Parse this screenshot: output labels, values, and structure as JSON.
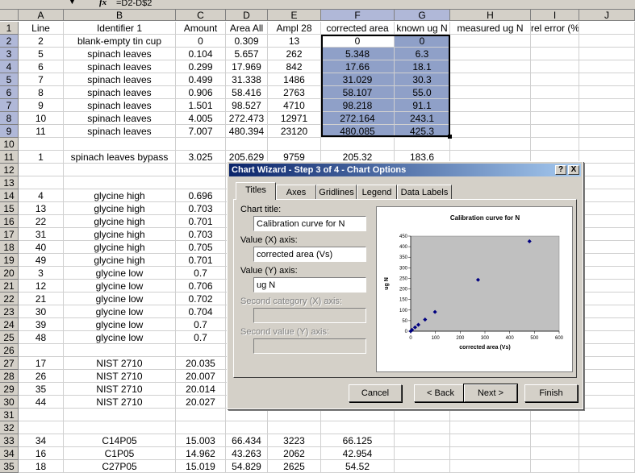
{
  "formula_bar": {
    "formula": "=D2-D$2"
  },
  "columns": [
    "A",
    "B",
    "C",
    "D",
    "E",
    "F",
    "G",
    "H",
    "I",
    "J"
  ],
  "rows": [
    {
      "n": "1",
      "cells": [
        "Line",
        "Identifier 1",
        "Amount",
        "Area All",
        "Ampl  28",
        "corrected area",
        "known ug N",
        "measured ug N",
        "rel error (%)",
        ""
      ]
    },
    {
      "n": "2",
      "cells": [
        "2",
        "blank-empty tin cup",
        "0",
        "0.309",
        "13",
        "0",
        "0",
        "",
        "",
        ""
      ]
    },
    {
      "n": "3",
      "cells": [
        "5",
        "spinach leaves",
        "0.104",
        "5.657",
        "262",
        "5.348",
        "6.3",
        "",
        "",
        ""
      ]
    },
    {
      "n": "4",
      "cells": [
        "6",
        "spinach leaves",
        "0.299",
        "17.969",
        "842",
        "17.66",
        "18.1",
        "",
        "",
        ""
      ]
    },
    {
      "n": "5",
      "cells": [
        "7",
        "spinach leaves",
        "0.499",
        "31.338",
        "1486",
        "31.029",
        "30.3",
        "",
        "",
        ""
      ]
    },
    {
      "n": "6",
      "cells": [
        "8",
        "spinach leaves",
        "0.906",
        "58.416",
        "2763",
        "58.107",
        "55.0",
        "",
        "",
        ""
      ]
    },
    {
      "n": "7",
      "cells": [
        "9",
        "spinach leaves",
        "1.501",
        "98.527",
        "4710",
        "98.218",
        "91.1",
        "",
        "",
        ""
      ]
    },
    {
      "n": "8",
      "cells": [
        "10",
        "spinach leaves",
        "4.005",
        "272.473",
        "12971",
        "272.164",
        "243.1",
        "",
        "",
        ""
      ]
    },
    {
      "n": "9",
      "cells": [
        "11",
        "spinach leaves",
        "7.007",
        "480.394",
        "23120",
        "480.085",
        "425.3",
        "",
        "",
        ""
      ]
    },
    {
      "n": "10",
      "cells": [
        "",
        "",
        "",
        "",
        "",
        "",
        "",
        "",
        "",
        ""
      ]
    },
    {
      "n": "11",
      "cells": [
        "1",
        "spinach leaves bypass",
        "3.025",
        "205.629",
        "9759",
        "205.32",
        "183.6",
        "",
        "",
        ""
      ]
    },
    {
      "n": "12",
      "cells": [
        "",
        "",
        "",
        "",
        "",
        "",
        "",
        "",
        "",
        ""
      ]
    },
    {
      "n": "13",
      "cells": [
        "",
        "",
        "",
        "",
        "",
        "",
        "",
        "",
        "",
        ""
      ]
    },
    {
      "n": "14",
      "cells": [
        "4",
        "glycine high",
        "0.696",
        "",
        "",
        "",
        "",
        "",
        "",
        ""
      ]
    },
    {
      "n": "15",
      "cells": [
        "13",
        "glycine high",
        "0.703",
        "",
        "",
        "",
        "",
        "",
        "",
        ""
      ]
    },
    {
      "n": "16",
      "cells": [
        "22",
        "glycine high",
        "0.701",
        "",
        "",
        "",
        "",
        "",
        "",
        ""
      ]
    },
    {
      "n": "17",
      "cells": [
        "31",
        "glycine high",
        "0.703",
        "",
        "",
        "",
        "",
        "",
        "",
        ""
      ]
    },
    {
      "n": "18",
      "cells": [
        "40",
        "glycine high",
        "0.705",
        "",
        "",
        "",
        "",
        "",
        "",
        ""
      ]
    },
    {
      "n": "19",
      "cells": [
        "49",
        "glycine high",
        "0.701",
        "",
        "",
        "",
        "",
        "",
        "",
        ""
      ]
    },
    {
      "n": "20",
      "cells": [
        "3",
        "glycine low",
        "0.7",
        "",
        "",
        "",
        "",
        "",
        "",
        ""
      ]
    },
    {
      "n": "21",
      "cells": [
        "12",
        "glycine low",
        "0.706",
        "",
        "",
        "",
        "",
        "",
        "",
        ""
      ]
    },
    {
      "n": "22",
      "cells": [
        "21",
        "glycine low",
        "0.702",
        "",
        "",
        "",
        "",
        "",
        "",
        ""
      ]
    },
    {
      "n": "23",
      "cells": [
        "30",
        "glycine low",
        "0.704",
        "",
        "",
        "",
        "",
        "",
        "",
        ""
      ]
    },
    {
      "n": "24",
      "cells": [
        "39",
        "glycine low",
        "0.7",
        "",
        "",
        "",
        "",
        "",
        "",
        ""
      ]
    },
    {
      "n": "25",
      "cells": [
        "48",
        "glycine low",
        "0.7",
        "",
        "",
        "",
        "",
        "",
        "",
        ""
      ]
    },
    {
      "n": "26",
      "cells": [
        "",
        "",
        "",
        "",
        "",
        "",
        "",
        "",
        "",
        ""
      ]
    },
    {
      "n": "27",
      "cells": [
        "17",
        "NIST 2710",
        "20.035",
        "",
        "",
        "",
        "",
        "",
        "",
        ""
      ]
    },
    {
      "n": "28",
      "cells": [
        "26",
        "NIST 2710",
        "20.007",
        "",
        "",
        "",
        "",
        "",
        "",
        ""
      ]
    },
    {
      "n": "29",
      "cells": [
        "35",
        "NIST 2710",
        "20.014",
        "",
        "",
        "",
        "",
        "",
        "",
        ""
      ]
    },
    {
      "n": "30",
      "cells": [
        "44",
        "NIST 2710",
        "20.027",
        "",
        "",
        "",
        "",
        "",
        "",
        ""
      ]
    },
    {
      "n": "31",
      "cells": [
        "",
        "",
        "",
        "",
        "",
        "",
        "",
        "",
        "",
        ""
      ]
    },
    {
      "n": "32",
      "cells": [
        "",
        "",
        "",
        "",
        "",
        "",
        "",
        "",
        "",
        ""
      ]
    },
    {
      "n": "33",
      "cells": [
        "34",
        "C14P05",
        "15.003",
        "66.434",
        "3223",
        "66.125",
        "",
        "",
        "",
        ""
      ]
    },
    {
      "n": "34",
      "cells": [
        "16",
        "C1P05",
        "14.962",
        "43.263",
        "2062",
        "42.954",
        "",
        "",
        "",
        ""
      ]
    },
    {
      "n": "35",
      "cells": [
        "18",
        "C27P05",
        "15.019",
        "54.829",
        "2625",
        "54.52",
        "",
        "",
        "",
        ""
      ]
    }
  ],
  "dialog": {
    "title": "Chart Wizard - Step 3 of 4 - Chart Options",
    "help_label": "?",
    "close_label": "X",
    "tabs": [
      "Titles",
      "Axes",
      "Gridlines",
      "Legend",
      "Data Labels"
    ],
    "chart_title_label": "Chart title:",
    "chart_title_value": "Calibration curve for N",
    "x_axis_label": "Value (X) axis:",
    "x_axis_value": "corrected area (Vs)",
    "y_axis_label": "Value (Y) axis:",
    "y_axis_value": "ug N",
    "second_x_label": "Second category (X) axis:",
    "second_y_label": "Second value (Y) axis:",
    "buttons": {
      "cancel": "Cancel",
      "back": "< Back",
      "next": "Next >",
      "finish": "Finish"
    }
  },
  "chart_data": {
    "type": "scatter",
    "title": "Calibration curve for N",
    "xlabel": "corrected area (Vs)",
    "ylabel": "ug N",
    "xlim": [
      0,
      600
    ],
    "ylim": [
      0,
      450
    ],
    "xticks": [
      "0",
      "100",
      "200",
      "300",
      "400",
      "500",
      "600"
    ],
    "yticks": [
      "0",
      "50",
      "100",
      "150",
      "200",
      "250",
      "300",
      "350",
      "400",
      "450"
    ],
    "x": [
      0,
      5.348,
      17.66,
      31.029,
      58.107,
      98.218,
      272.164,
      480.085
    ],
    "y": [
      0,
      6.3,
      18.1,
      30.3,
      55.0,
      91.1,
      243.1,
      425.3
    ],
    "marker_color": "#000080",
    "plot_background": "#c0c0c0"
  }
}
